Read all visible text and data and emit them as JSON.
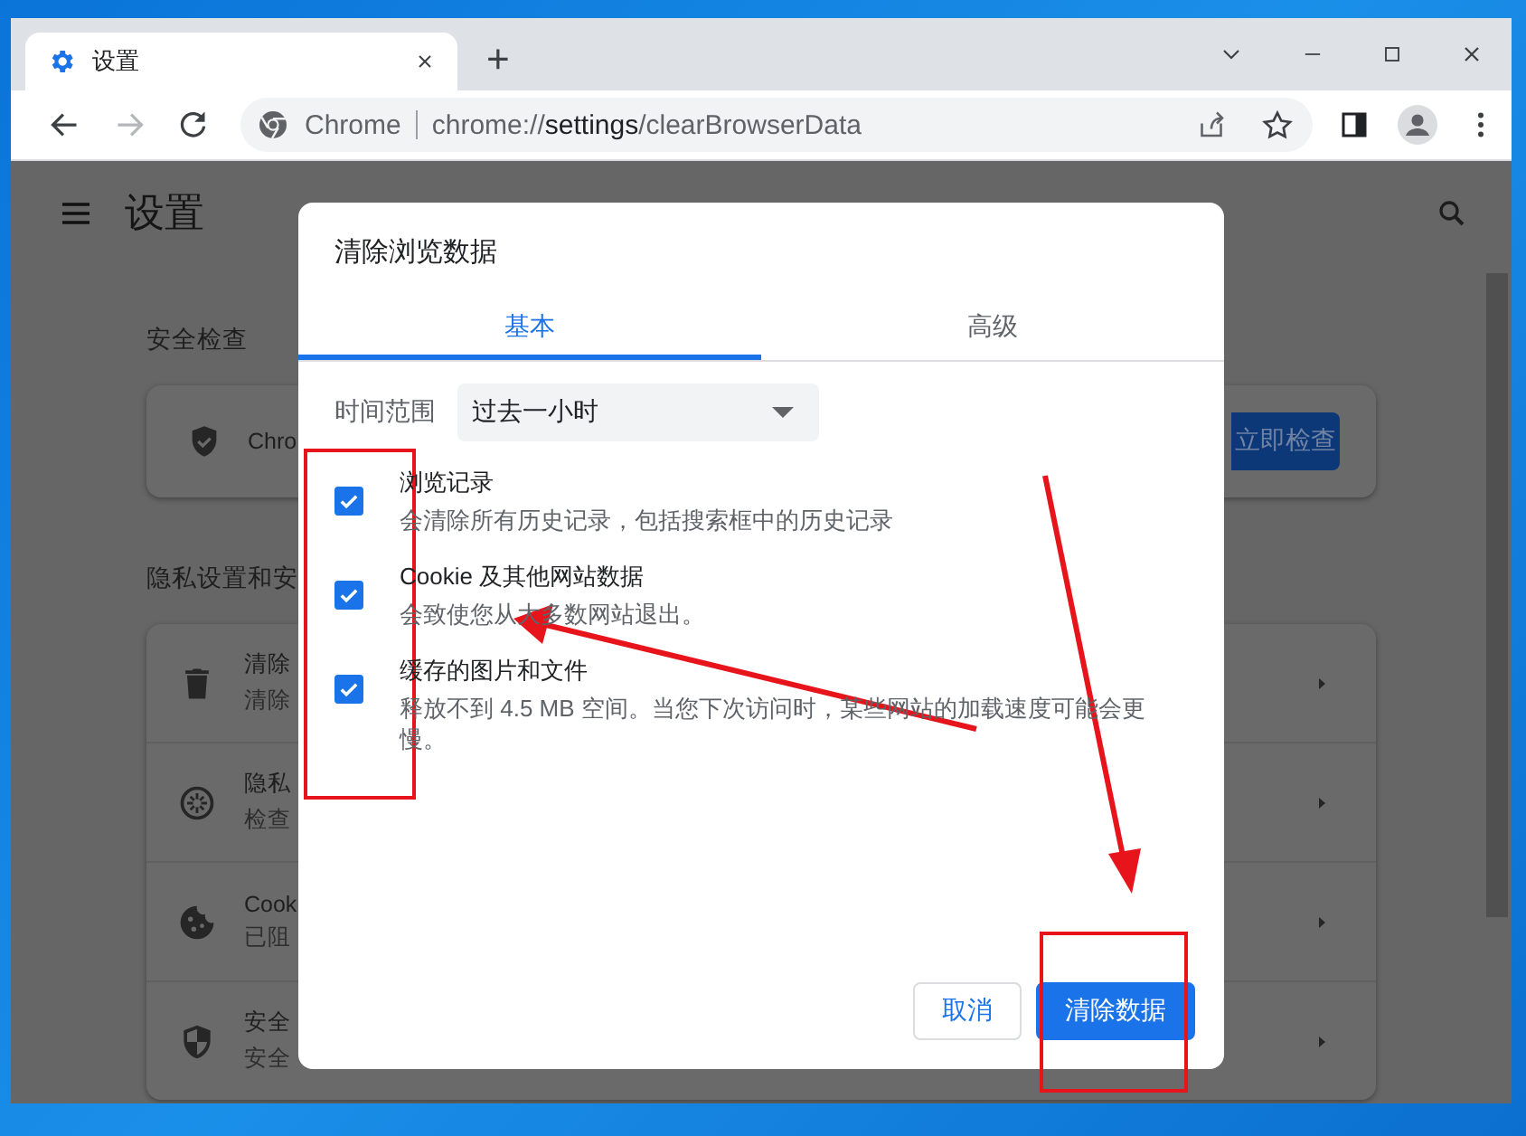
{
  "tabs": [
    {
      "title": "设置",
      "selected": true
    }
  ],
  "new_tab": "+",
  "address_bar": {
    "site_label": "Chrome",
    "url": "chrome://**settings**/clearBrowserData"
  },
  "settings": {
    "title": "设置",
    "safety_check": {
      "heading": "安全检查",
      "item_title": "Chro",
      "button": "立即检查"
    },
    "privacy": {
      "heading": "隐私设置和安",
      "items": [
        {
          "kind": "trash",
          "title": "清除",
          "subtitle": "清除"
        },
        {
          "kind": "compass",
          "title": "隐私",
          "subtitle": "检查"
        },
        {
          "kind": "cookie",
          "title": "Cook",
          "subtitle": "已阻"
        },
        {
          "kind": "shield",
          "title": "安全",
          "subtitle": "安全"
        }
      ]
    }
  },
  "dialog": {
    "title": "清除浏览数据",
    "tabs": [
      {
        "label": "基本",
        "selected": true
      },
      {
        "label": "高级",
        "selected": false
      }
    ],
    "time_range": {
      "label": "时间范围",
      "value": "过去一小时"
    },
    "options": [
      {
        "title": "浏览记录",
        "description": "会清除所有历史记录，包括搜索框中的历史记录",
        "checked": true
      },
      {
        "title": "Cookie 及其他网站数据",
        "description": "会致使您从大多数网站退出。",
        "checked": true
      },
      {
        "title": "缓存的图片和文件",
        "description": "释放不到 4.5 MB 空间。当您下次访问时，某些网站的加载速度可能会更慢。",
        "checked": true
      }
    ],
    "buttons": [
      {
        "label": "取消",
        "kind": "secondary"
      },
      {
        "label": "清除数据",
        "kind": "primary"
      }
    ]
  }
}
